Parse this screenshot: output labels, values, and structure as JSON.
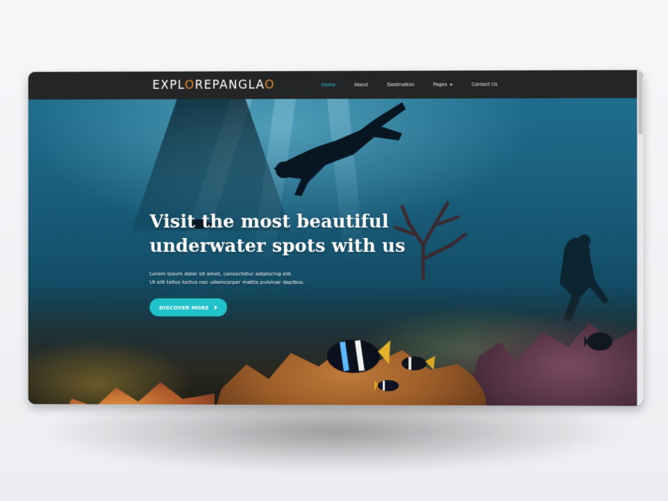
{
  "site": {
    "logo_main": "EXPLOREPANGLAO",
    "logo_part1": "EXPL",
    "logo_accent": "O",
    "logo_part2": "REPANGLA",
    "logo_accent2": "O"
  },
  "nav": {
    "items": [
      {
        "label": "Home",
        "active": true
      },
      {
        "label": "About"
      },
      {
        "label": "Destination"
      },
      {
        "label": "Pages"
      },
      {
        "label": "Contact Us"
      }
    ]
  },
  "hero": {
    "title_line1": "Visit the most beautiful",
    "title_line2": "underwater spots with us",
    "sub_line1": "Lorem ipsum dolor sit amet, consectetur adipiscing elit.",
    "sub_line2": "Ut elit tellus luctus nec ullamcorper mattis pulvinar dapibus.",
    "cta_label": "DISCOVER MORE"
  },
  "colors": {
    "accent": "#22c2cb",
    "logo_accent": "#e2872c",
    "navbar": "#232527"
  },
  "icons": {
    "pages_dropdown": "chevron-down-icon",
    "cta_arrow": "arrow-right-icon"
  }
}
